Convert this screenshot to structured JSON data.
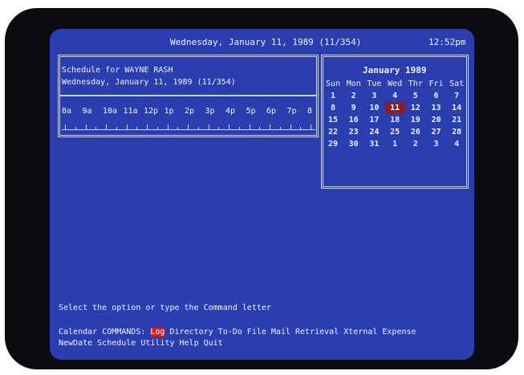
{
  "header": {
    "date": "Wednesday, January 11, 1989 (11/354)",
    "time": "12:52pm"
  },
  "schedule": {
    "title": "Schedule for WAYNE RASH",
    "date": "Wednesday, January 11, 1989 (11/354)",
    "hours": [
      "8a",
      "9a",
      "10a",
      "11a",
      "12p",
      "1p",
      "2p",
      "3p",
      "4p",
      "5p",
      "6p",
      "7p",
      "8"
    ]
  },
  "calendar": {
    "month": "January 1989",
    "weekdays": [
      "Sun",
      "Mon",
      "Tue",
      "Wed",
      "Thr",
      "Fri",
      "Sat"
    ],
    "weeks": [
      [
        "1",
        "2",
        "3",
        "4",
        "5",
        "6",
        "7"
      ],
      [
        "8",
        "9",
        "10",
        "11",
        "12",
        "13",
        "14"
      ],
      [
        "15",
        "16",
        "17",
        "18",
        "19",
        "20",
        "21"
      ],
      [
        "22",
        "23",
        "24",
        "25",
        "26",
        "27",
        "28"
      ],
      [
        "29",
        "30",
        "31",
        "1",
        "2",
        "3",
        "4"
      ]
    ],
    "selected_day": "11"
  },
  "footer": {
    "prompt": "Select the option or type the Command letter",
    "commands_prefix": "Calendar COMMANDS: ",
    "highlighted_command": "Log",
    "commands_rest": " Directory To-Do File Mail Retrieval Xternal Expense",
    "commands_line2": "NewDate Schedule Utility Help Quit"
  },
  "colors": {
    "screen_background": "#2a3eb0",
    "text": "#eef0ff",
    "highlight": "#c81e2e",
    "today_marker": "#8c1c28"
  }
}
